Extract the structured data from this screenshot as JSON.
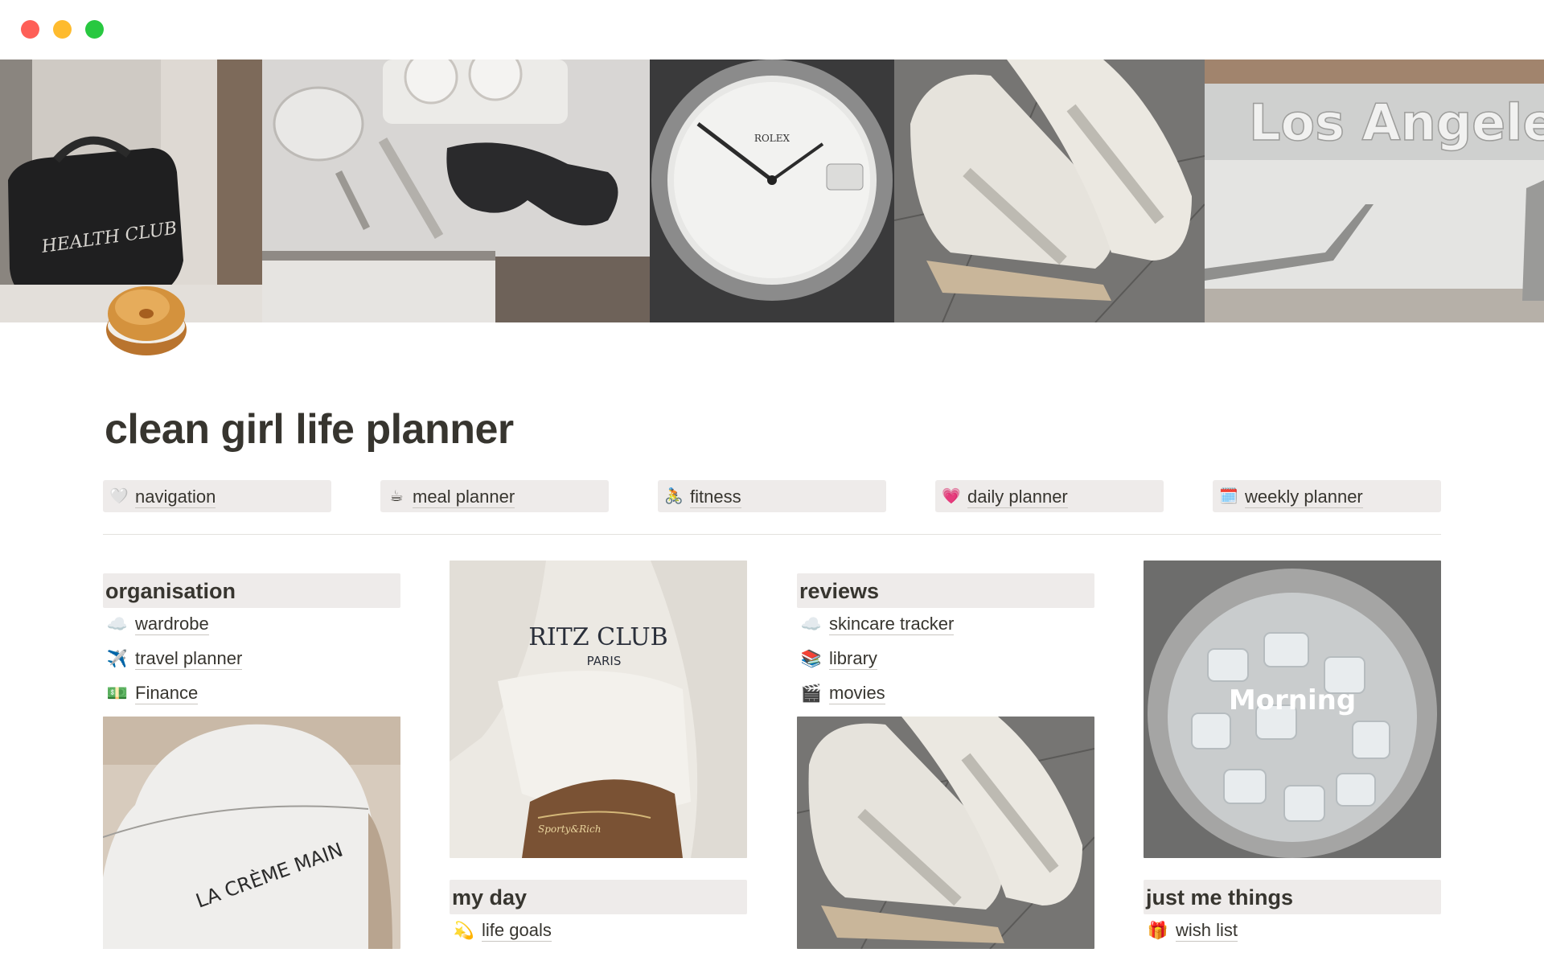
{
  "window": {
    "controls": [
      "close",
      "minimize",
      "zoom"
    ],
    "colors": {
      "close": "#fe5f57",
      "minimize": "#febb2e",
      "zoom": "#28c840"
    }
  },
  "cover": {
    "images": [
      "health-club-bag",
      "table-with-sunglasses",
      "rolex-watch",
      "sneakers",
      "los-angeles-escalator"
    ],
    "sign_text": "Los Angele",
    "bag_text": "HEALTH CLUB",
    "watch_text": "ROLEX"
  },
  "page": {
    "icon": "bagel-icon",
    "title": "clean girl life planner"
  },
  "nav_buttons": [
    {
      "icon": "🤍",
      "label": "navigation"
    },
    {
      "icon": "☕",
      "label": "meal planner"
    },
    {
      "icon": "🚴",
      "label": "fitness"
    },
    {
      "icon": "💗",
      "label": "daily planner"
    },
    {
      "icon": "🗓️",
      "label": "weekly planner"
    }
  ],
  "columns": {
    "col1": {
      "heading": "organisation",
      "links": [
        {
          "icon": "☁️",
          "label": "wardrobe"
        },
        {
          "icon": "✈️",
          "label": "travel planner"
        },
        {
          "icon": "💵",
          "label": "Finance"
        }
      ],
      "image": {
        "name": "la-creme-main",
        "caption": "LA CRÈME MAIN"
      }
    },
    "col2": {
      "image": {
        "name": "ritz-club-robe",
        "caption": "RITZ CLUB",
        "subcaption": "PARIS",
        "bracelet": "Sporty&Rich"
      },
      "heading": "my day",
      "links": [
        {
          "icon": "💫",
          "label": "life goals"
        }
      ]
    },
    "col3": {
      "heading": "reviews",
      "links": [
        {
          "icon": "☁️",
          "label": "skincare tracker"
        },
        {
          "icon": "📚",
          "label": "library"
        },
        {
          "icon": "🎬",
          "label": "movies"
        }
      ],
      "image": {
        "name": "sneakers"
      }
    },
    "col4": {
      "image": {
        "name": "ice-bowl",
        "caption": "Morning"
      },
      "heading": "just me things",
      "links": [
        {
          "icon": "🎁",
          "label": "wish list"
        }
      ]
    }
  },
  "accent_colors": {
    "block_bg": "#eeebea",
    "text": "#37352f"
  }
}
